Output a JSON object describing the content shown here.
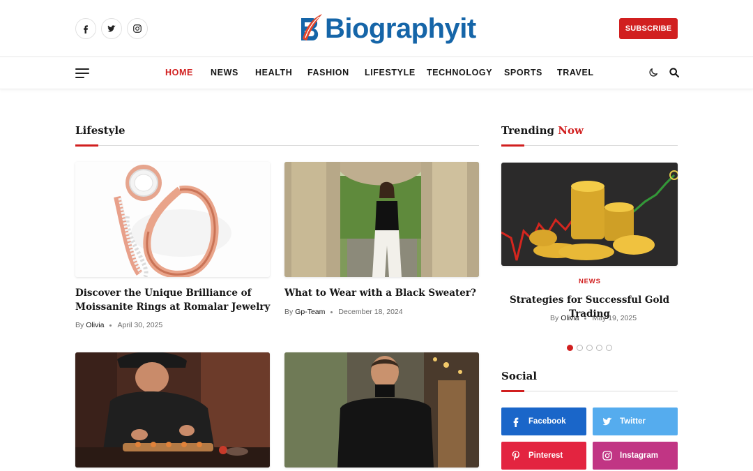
{
  "header": {
    "logo_text": "Biographyit",
    "subscribe_label": "SUBSCRIBE",
    "social_icons": [
      "facebook-icon",
      "twitter-icon",
      "instagram-icon"
    ]
  },
  "nav": {
    "items": [
      "HOME",
      "NEWS",
      "HEALTH",
      "FASHION",
      "LIFESTYLE",
      "TECHNOLOGY",
      "SPORTS",
      "TRAVEL"
    ],
    "active": "HOME"
  },
  "lifestyle": {
    "heading": "Lifestyle",
    "posts": [
      {
        "title": "Discover the Unique Brilliance of Moissanite Rings at Romalar Jewelry",
        "by": "By",
        "author": "Olivia",
        "date": "April 30, 2025"
      },
      {
        "title": "What to Wear with a Black Sweater?",
        "by": "By",
        "author": "Gp-Team",
        "date": "December 18, 2024"
      }
    ]
  },
  "trending": {
    "heading_a": "Trending",
    "heading_b": "Now",
    "category": "NEWS",
    "title": "Strategies for Successful Gold Trading",
    "by": "By",
    "author": "Olivia",
    "date": "May 19, 2025",
    "slide_count": 5,
    "active_slide": 1
  },
  "social": {
    "heading": "Social",
    "buttons": [
      {
        "label": "Facebook",
        "color": "#1a66c9"
      },
      {
        "label": "Twitter",
        "color": "#55acee"
      },
      {
        "label": "Pinterest",
        "color": "#e32440"
      },
      {
        "label": "Instagram",
        "color": "#c13584"
      }
    ]
  },
  "colors": {
    "accent": "#d11f1f",
    "brand_blue": "#1565a8"
  }
}
